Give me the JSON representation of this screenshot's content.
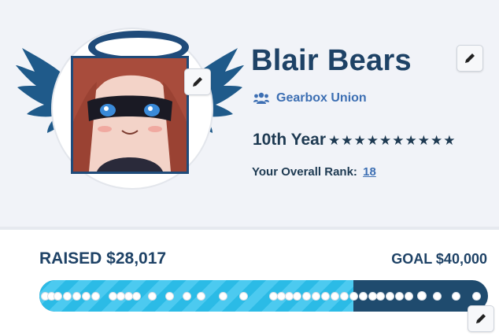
{
  "profile": {
    "name": "Blair Bears",
    "team": "Gearbox Union",
    "year_label": "10th Year",
    "stars": 10,
    "rank_prefix": "Your Overall Rank:",
    "rank": "18"
  },
  "fundraising": {
    "raised": "RAISED $28,017",
    "goal": "GOAL $40,000",
    "progress": 0.7004
  },
  "colors": {
    "navy": "#1e4266",
    "accent_blue": "#3d6fb3",
    "bar_fill": "#2bbbe6",
    "bar_track": "#1f4b6e"
  },
  "icons": {
    "edit": "pencil-icon",
    "team": "users-icon",
    "star": "star-icon"
  }
}
